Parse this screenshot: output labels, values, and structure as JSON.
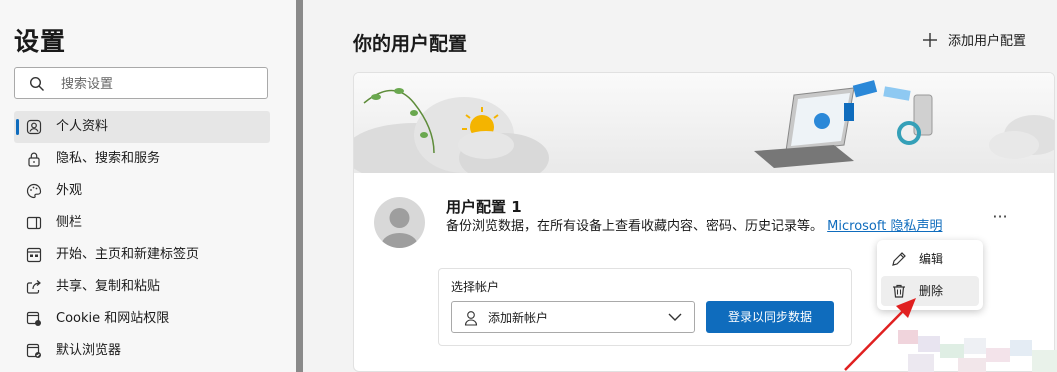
{
  "sidebar": {
    "title": "设置",
    "search_placeholder": "搜索设置",
    "items": [
      {
        "label": "个人资料",
        "icon": "profile-icon",
        "active": true
      },
      {
        "label": "隐私、搜索和服务",
        "icon": "lock-icon"
      },
      {
        "label": "外观",
        "icon": "palette-icon"
      },
      {
        "label": "侧栏",
        "icon": "sidebar-icon"
      },
      {
        "label": "开始、主页和新建标签页",
        "icon": "home-tab-icon"
      },
      {
        "label": "共享、复制和粘贴",
        "icon": "share-icon"
      },
      {
        "label": "Cookie 和网站权限",
        "icon": "cookie-icon"
      },
      {
        "label": "默认浏览器",
        "icon": "browser-icon"
      }
    ]
  },
  "main": {
    "title": "你的用户配置",
    "add_profile_label": "添加用户配置"
  },
  "profile": {
    "name": "用户配置 1",
    "description": "备份浏览数据，在所有设备上查看收藏内容、密码、历史记录等。",
    "privacy_link": "Microsoft 隐私声明",
    "more_label": "···"
  },
  "account": {
    "label": "选择帐户",
    "select_value": "添加新帐户",
    "sync_button": "登录以同步数据"
  },
  "context_menu": {
    "items": [
      {
        "label": "编辑",
        "icon": "pencil-icon"
      },
      {
        "label": "删除",
        "icon": "trash-icon"
      }
    ]
  },
  "colors": {
    "accent": "#0f6cbd",
    "annotation_arrow": "#e02020"
  }
}
